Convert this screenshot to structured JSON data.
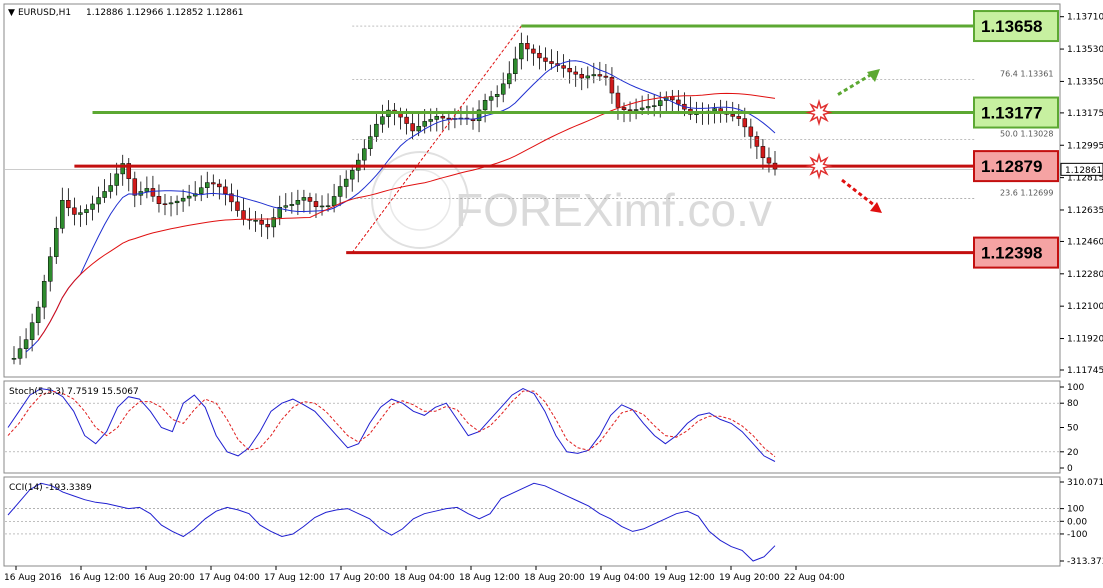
{
  "header": {
    "symbol": "EURUSD,H1",
    "ohlc": "1.12886 1.12966 1.12852 1.12861"
  },
  "colors": {
    "bull": "#2e8b2e",
    "bear": "#d11b1b",
    "ma_fast": "#1f2fd0",
    "ma_slow": "#e01010",
    "support_line": "#c30f0f",
    "resist_line": "#5ca832",
    "green_label_bg": "#c7f0a0",
    "red_label_bg": "#f5a3a3",
    "stoch_main": "#2020d0",
    "stoch_signal": "#e02020",
    "cci": "#2020d0"
  },
  "watermark": "FOREXimf.co.v",
  "chart_data": [
    {
      "type": "line",
      "name": "price",
      "ylim": [
        1.11745,
        1.13725
      ],
      "yticks": [
        "1.13710",
        "1.13530",
        "1.13350",
        "1.13175",
        "1.12995",
        "1.12815",
        "1.12635",
        "1.12460",
        "1.12280",
        "1.12100",
        "1.11920",
        "1.11745"
      ],
      "x_labels": [
        "16 Aug 2016",
        "16 Aug 12:00",
        "16 Aug 20:00",
        "17 Aug 04:00",
        "17 Aug 12:00",
        "17 Aug 20:00",
        "18 Aug 04:00",
        "18 Aug 12:00",
        "18 Aug 20:00",
        "19 Aug 04:00",
        "19 Aug 12:00",
        "19 Aug 20:00",
        "22 Aug 04:00"
      ],
      "close_path": [
        [
          0,
          1.1181
        ],
        [
          2,
          1.1188
        ],
        [
          4,
          1.1205
        ],
        [
          6,
          1.1235
        ],
        [
          8,
          1.127
        ],
        [
          10,
          1.1265
        ],
        [
          12,
          1.1268
        ],
        [
          14,
          1.1272
        ],
        [
          16,
          1.1275
        ],
        [
          18,
          1.1285
        ],
        [
          20,
          1.1268
        ],
        [
          22,
          1.1275
        ],
        [
          24,
          1.127
        ],
        [
          26,
          1.1272
        ],
        [
          28,
          1.1273
        ],
        [
          30,
          1.1272
        ],
        [
          32,
          1.1275
        ],
        [
          34,
          1.1272
        ],
        [
          36,
          1.1266
        ],
        [
          38,
          1.126
        ],
        [
          40,
          1.1262
        ],
        [
          42,
          1.1258
        ],
        [
          44,
          1.1266
        ],
        [
          46,
          1.1264
        ],
        [
          48,
          1.1266
        ],
        [
          50,
          1.1262
        ],
        [
          52,
          1.1266
        ],
        [
          54,
          1.128
        ],
        [
          56,
          1.129
        ],
        [
          58,
          1.13
        ],
        [
          60,
          1.131
        ],
        [
          62,
          1.1315
        ],
        [
          64,
          1.1311
        ],
        [
          66,
          1.1306
        ],
        [
          68,
          1.1315
        ],
        [
          70,
          1.132
        ],
        [
          72,
          1.1318
        ],
        [
          74,
          1.1315
        ],
        [
          76,
          1.131
        ],
        [
          78,
          1.132
        ],
        [
          80,
          1.1325
        ],
        [
          82,
          1.134
        ],
        [
          84,
          1.136
        ],
        [
          86,
          1.1355
        ],
        [
          88,
          1.1348
        ],
        [
          90,
          1.1342
        ],
        [
          92,
          1.1336
        ],
        [
          94,
          1.1333
        ],
        [
          96,
          1.1338
        ],
        [
          98,
          1.134
        ],
        [
          100,
          1.1325
        ],
        [
          102,
          1.1322
        ],
        [
          104,
          1.132
        ],
        [
          106,
          1.1318
        ],
        [
          108,
          1.1322
        ],
        [
          110,
          1.132
        ],
        [
          112,
          1.1318
        ],
        [
          114,
          1.1322
        ],
        [
          116,
          1.1324
        ],
        [
          118,
          1.1318
        ],
        [
          120,
          1.1312
        ],
        [
          122,
          1.13
        ],
        [
          124,
          1.1289
        ],
        [
          126,
          1.1286
        ]
      ]
    },
    {
      "type": "line",
      "name": "Stoch(5,3,3) 7.7519 15.5067",
      "ylim": [
        0,
        100
      ],
      "yticks": [
        "100",
        "80",
        "50",
        "20",
        "0"
      ],
      "main": [
        50,
        70,
        90,
        98,
        96,
        88,
        70,
        40,
        30,
        45,
        75,
        88,
        85,
        70,
        50,
        45,
        80,
        90,
        75,
        40,
        20,
        15,
        25,
        45,
        70,
        80,
        85,
        78,
        70,
        55,
        40,
        25,
        30,
        55,
        75,
        85,
        80,
        70,
        65,
        75,
        80,
        60,
        40,
        45,
        60,
        75,
        90,
        98,
        92,
        70,
        40,
        20,
        18,
        22,
        40,
        65,
        78,
        72,
        55,
        40,
        30,
        40,
        55,
        65,
        68,
        60,
        55,
        45,
        30,
        15,
        8
      ],
      "signal": [
        40,
        55,
        75,
        90,
        95,
        92,
        85,
        70,
        50,
        40,
        50,
        70,
        82,
        82,
        75,
        60,
        55,
        72,
        85,
        80,
        60,
        35,
        22,
        25,
        40,
        60,
        75,
        82,
        80,
        70,
        55,
        40,
        32,
        42,
        60,
        78,
        83,
        78,
        70,
        70,
        76,
        72,
        55,
        45,
        52,
        66,
        82,
        95,
        95,
        82,
        60,
        35,
        25,
        22,
        32,
        50,
        68,
        72,
        66,
        52,
        40,
        38,
        46,
        58,
        64,
        64,
        60,
        52,
        40,
        25,
        14
      ]
    },
    {
      "type": "line",
      "name": "CCI(14) -193.3389",
      "ylim": [
        -313.3734,
        310.0714
      ],
      "yticks": [
        "310.0714",
        "100",
        "0.00",
        "-100",
        "-313.3734"
      ],
      "values": [
        50,
        150,
        250,
        300,
        280,
        230,
        200,
        170,
        150,
        140,
        120,
        100,
        110,
        60,
        -30,
        -80,
        -120,
        -60,
        20,
        80,
        110,
        90,
        60,
        -30,
        -80,
        -120,
        -100,
        -40,
        30,
        70,
        90,
        100,
        60,
        20,
        -60,
        -110,
        -60,
        20,
        60,
        80,
        100,
        110,
        60,
        20,
        60,
        180,
        220,
        260,
        300,
        280,
        240,
        200,
        160,
        120,
        60,
        20,
        -40,
        -80,
        -60,
        -20,
        20,
        60,
        80,
        40,
        -80,
        -150,
        -200,
        -230,
        -313,
        -280,
        -193
      ]
    }
  ],
  "level_labels": [
    {
      "id": "lvl-1",
      "text": "1.13658",
      "kind": "resist",
      "price": 1.13658
    },
    {
      "id": "lvl-2",
      "text": "1.13177",
      "kind": "resist",
      "price": 1.13177
    },
    {
      "id": "lvl-3",
      "text": "1.12879",
      "kind": "support",
      "price": 1.12879
    },
    {
      "id": "lvl-4",
      "text": "1.12398",
      "kind": "support",
      "price": 1.12398
    }
  ],
  "fib_labels": [
    {
      "text": "76.4",
      "value": "1.13361"
    },
    {
      "text": "50.0",
      "value": "1.13028"
    },
    {
      "text": "23.6",
      "value": "1.12699"
    }
  ],
  "current_price": "1.12861"
}
